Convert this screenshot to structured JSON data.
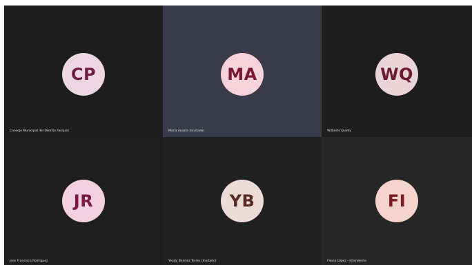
{
  "participants": [
    {
      "initials": "CP",
      "name": "Consejo Municipal del Distrito Farquez",
      "tile_bg": "#1d1d1d",
      "avatar_bg": "#ecd7e3",
      "avatar_fg": "#6e1f45"
    },
    {
      "initials": "MA",
      "name": "Maria Acosta (Invitado)",
      "tile_bg": "#3a3a48",
      "avatar_bg": "#f6d2dc",
      "avatar_fg": "#7a1735"
    },
    {
      "initials": "WQ",
      "name": "Wilberto Quintu",
      "tile_bg": "#1d1d1d",
      "avatar_bg": "#e9d4d9",
      "avatar_fg": "#6a1a2c"
    },
    {
      "initials": "JR",
      "name": "Jose Francisco Rodriguez",
      "tile_bg": "#1e1e1e",
      "avatar_bg": "#f3d1df",
      "avatar_fg": "#7a1a3e"
    },
    {
      "initials": "YB",
      "name": "Yeudy Benitez Torres (Invitado)",
      "tile_bg": "#202020",
      "avatar_bg": "#ebdcd6",
      "avatar_fg": "#5a2b24"
    },
    {
      "initials": "FI",
      "name": "Flavia López - Intendente",
      "tile_bg": "#262626",
      "avatar_bg": "#f4d3cc",
      "avatar_fg": "#7a1a22"
    }
  ]
}
